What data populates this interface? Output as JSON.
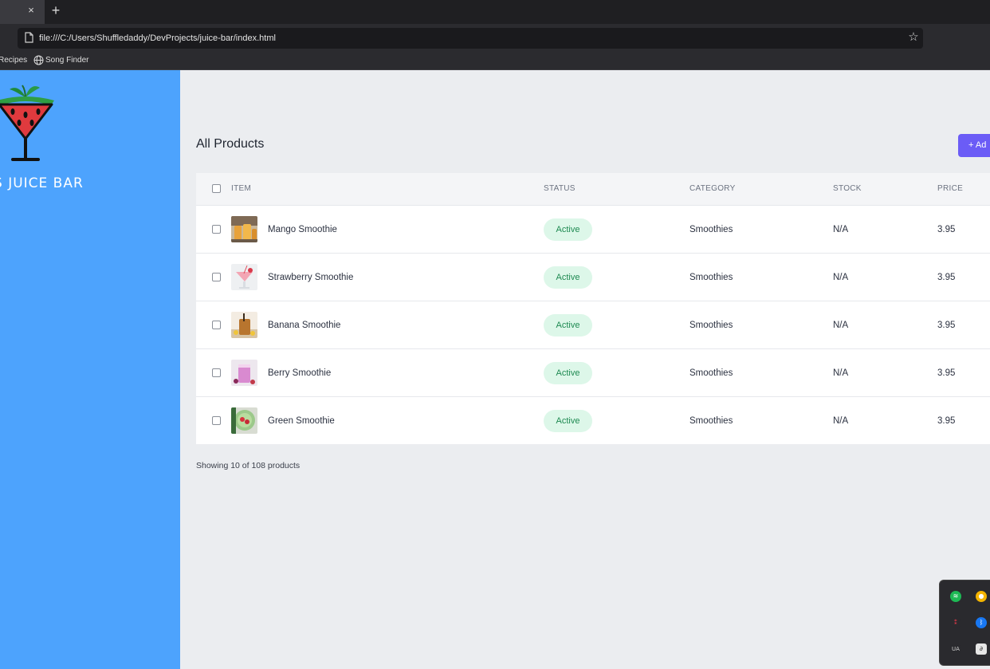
{
  "browser": {
    "tab_close": "×",
    "new_tab": "+",
    "url": "file:///C:/Users/Shuffledaddy/DevProjects/juice-bar/index.html",
    "star": "☆",
    "bookmarks": [
      "Recipes",
      "Song Finder"
    ]
  },
  "sidebar": {
    "brand": "S JUICE BAR",
    "accent_color": "#4da3fd"
  },
  "main": {
    "title": "All Products",
    "add_button": "+ Ad",
    "columns": [
      "ITEM",
      "STATUS",
      "CATEGORY",
      "STOCK",
      "PRICE"
    ],
    "rows": [
      {
        "item": "Mango Smoothie",
        "status": "Active",
        "category": "Smoothies",
        "stock": "N/A",
        "price": "3.95"
      },
      {
        "item": "Strawberry Smoothie",
        "status": "Active",
        "category": "Smoothies",
        "stock": "N/A",
        "price": "3.95"
      },
      {
        "item": "Banana Smoothie",
        "status": "Active",
        "category": "Smoothies",
        "stock": "N/A",
        "price": "3.95"
      },
      {
        "item": "Berry Smoothie",
        "status": "Active",
        "category": "Smoothies",
        "stock": "N/A",
        "price": "3.95"
      },
      {
        "item": "Green Smoothie",
        "status": "Active",
        "category": "Smoothies",
        "stock": "N/A",
        "price": "3.95"
      }
    ],
    "footer": "Showing 10 of 108 products"
  },
  "tray": {
    "icons": [
      "spotify-icon",
      "chrome-icon",
      "app-icon",
      "bluetooth-icon",
      "ua-icon",
      "steam-icon"
    ]
  }
}
